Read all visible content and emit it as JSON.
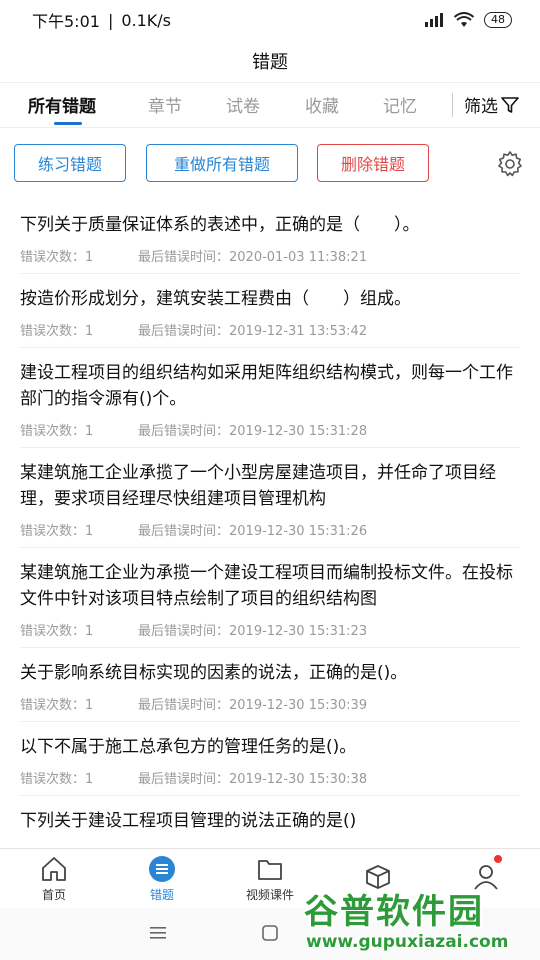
{
  "status_bar": {
    "time": "下午5:01",
    "net_speed": "0.1K/s",
    "battery": "48"
  },
  "header": {
    "title": "错题"
  },
  "tabs": [
    {
      "label": "所有错题",
      "active": true
    },
    {
      "label": "章节",
      "active": false
    },
    {
      "label": "试卷",
      "active": false
    },
    {
      "label": "收藏",
      "active": false
    },
    {
      "label": "记忆",
      "active": false
    }
  ],
  "filter": {
    "label": "筛选"
  },
  "actions": {
    "practice": "练习错题",
    "redo_all": "重做所有错题",
    "delete": "删除错题"
  },
  "list": {
    "count_label": "错误次数：",
    "time_label": "最后错误时间：",
    "items": [
      {
        "question": "下列关于质量保证体系的表述中，正确的是（　　）。",
        "count": "1",
        "time": "2020-01-03 11:38:21"
      },
      {
        "question": "按造价形成划分，建筑安装工程费由（　　）组成。",
        "count": "1",
        "time": "2019-12-31 13:53:42"
      },
      {
        "question": "建设工程项目的组织结构如采用矩阵组织结构模式，则每一个工作部门的指令源有()个。",
        "count": "1",
        "time": "2019-12-30 15:31:28"
      },
      {
        "question": "某建筑施工企业承揽了一个小型房屋建造项目，并任命了项目经理，要求项目经理尽快组建项目管理机构",
        "count": "1",
        "time": "2019-12-30 15:31:26"
      },
      {
        "question": "某建筑施工企业为承揽一个建设工程项目而编制投标文件。在投标文件中针对该项目特点绘制了项目的组织结构图",
        "count": "1",
        "time": "2019-12-30 15:31:23"
      },
      {
        "question": "关于影响系统目标实现的因素的说法，正确的是()。",
        "count": "1",
        "time": "2019-12-30 15:30:39"
      },
      {
        "question": "以下不属于施工总承包方的管理任务的是()。",
        "count": "1",
        "time": "2019-12-30 15:30:38"
      },
      {
        "question": "下列关于建设工程项目管理的说法正确的是()",
        "count": "",
        "time": ""
      }
    ]
  },
  "bottom_nav": [
    {
      "label": "首页",
      "icon": "home-icon"
    },
    {
      "label": "错题",
      "icon": "list-icon",
      "active": true
    },
    {
      "label": "视频课件",
      "icon": "folder-icon"
    },
    {
      "label": "",
      "icon": "cube-icon"
    },
    {
      "label": "",
      "icon": "user-icon"
    }
  ],
  "watermark": {
    "title": "谷普软件园",
    "url": "www.gupuxiazai.com"
  },
  "colors": {
    "accent": "#2a86d5",
    "danger": "#e04848",
    "watermark": "#2e9a3a"
  }
}
